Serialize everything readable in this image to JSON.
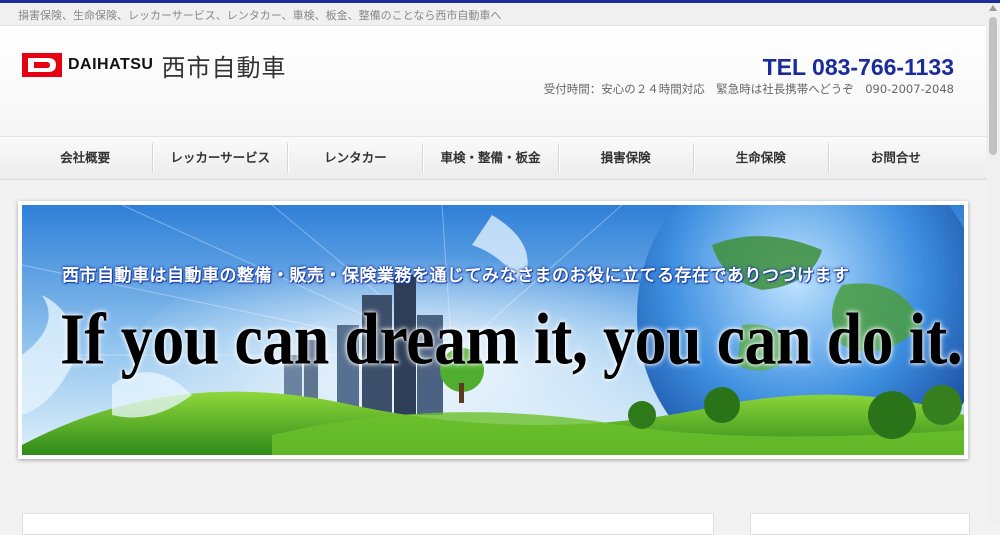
{
  "tagline": "損害保険、生命保険、レッカーサービス、レンタカー、車検、板金、整備のことなら西市自動車へ",
  "logo": {
    "brand": "DAIHATSU",
    "company": "西市自動車",
    "mark_color": "#e60012"
  },
  "contact": {
    "tel": "TEL 083-766-1133",
    "hours": "受付時間：安心の２４時間対応　緊急時は社長携帯へどうぞ　090-2007-2048",
    "tel_color": "#1a2b9c"
  },
  "nav": {
    "items": [
      {
        "label": "会社概要"
      },
      {
        "label": "レッカーサービス"
      },
      {
        "label": "レンタカー"
      },
      {
        "label": "車検・整備・板金"
      },
      {
        "label": "損害保険"
      },
      {
        "label": "生命保険"
      },
      {
        "label": "お問合せ"
      }
    ]
  },
  "hero": {
    "headline_jp": "西市自動車は自動車の整備・販売・保険業務を通じてみなさまのお役に立てる存在でありつづけます",
    "headline_en": "If you can dream it, you can do it."
  },
  "colors": {
    "accent": "#1a2b9c",
    "background": "#f2f2f2"
  }
}
